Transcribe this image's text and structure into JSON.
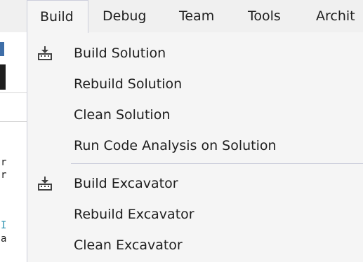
{
  "menubar": {
    "items": [
      {
        "label": "Build"
      },
      {
        "label": "Debug"
      },
      {
        "label": "Team"
      },
      {
        "label": "Tools"
      },
      {
        "label": "Archit"
      }
    ]
  },
  "editor": {
    "line_chars": [
      "r",
      "r",
      "I",
      "a"
    ]
  },
  "build_menu": {
    "items": [
      {
        "label": "Build Solution",
        "icon": "build-icon"
      },
      {
        "label": "Rebuild Solution"
      },
      {
        "label": "Clean Solution"
      },
      {
        "label": "Run Code Analysis on Solution"
      },
      {
        "label": "Build Excavator",
        "icon": "build-icon"
      },
      {
        "label": "Rebuild Excavator"
      },
      {
        "label": "Clean Excavator"
      }
    ]
  },
  "colors": {
    "menu_background": "#f5f5f5",
    "menu_border": "#cccedb",
    "text": "#1e1e1e",
    "icon_dark": "#424242"
  }
}
